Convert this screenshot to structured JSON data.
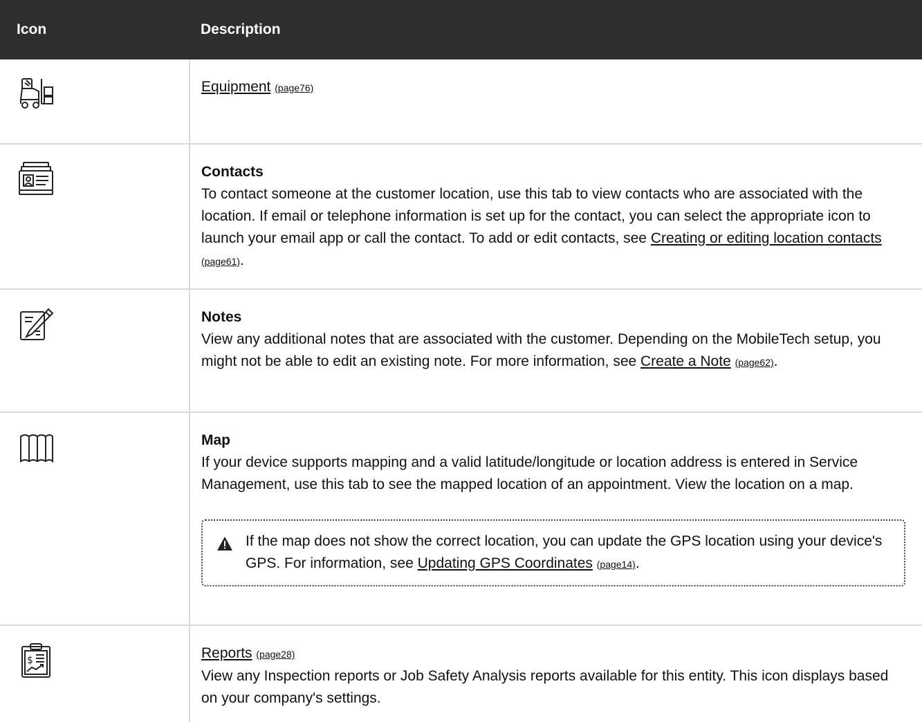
{
  "header": {
    "icon_col": "Icon",
    "desc_col": "Description"
  },
  "rows": [
    {
      "icon": "forklift-icon",
      "link": "Equipment",
      "page": "(page76)"
    },
    {
      "icon": "contact-card-icon",
      "title": "Contacts",
      "text": "To contact someone at the customer location, use this tab to view contacts who are associated with the location. If email or telephone information is set up for the contact, you can select the appropriate icon to launch your email app or call the contact. To add or edit contacts, see ",
      "link": "Creating or editing location contacts",
      "page": "(page61)",
      "after": "."
    },
    {
      "icon": "notepad-pencil-icon",
      "title": "Notes",
      "text": "View any additional notes that are associated with the customer. Depending on the MobileTech setup, you might not be able to edit an existing note. For more information, see ",
      "link": "Create a Note",
      "page": "(page62)",
      "after": "."
    },
    {
      "icon": "folded-map-icon",
      "title": "Map",
      "text": "If your device supports mapping and a valid latitude/longitude or location address is entered in Service Management, use this tab to see the mapped location of an appointment. View the location on a map.",
      "note": {
        "icon": "warning-triangle-icon",
        "text": "If the map does not show the correct location, you can update the GPS location using your device's GPS. For information, see ",
        "link": "Updating GPS Coordinates",
        "page": "(page14)",
        "after": "."
      }
    },
    {
      "icon": "clipboard-report-icon",
      "link": "Reports",
      "page": "(page28)",
      "text": "View any Inspection reports or Job Safety Analysis reports available for this entity. This icon displays based on your company's settings."
    }
  ]
}
